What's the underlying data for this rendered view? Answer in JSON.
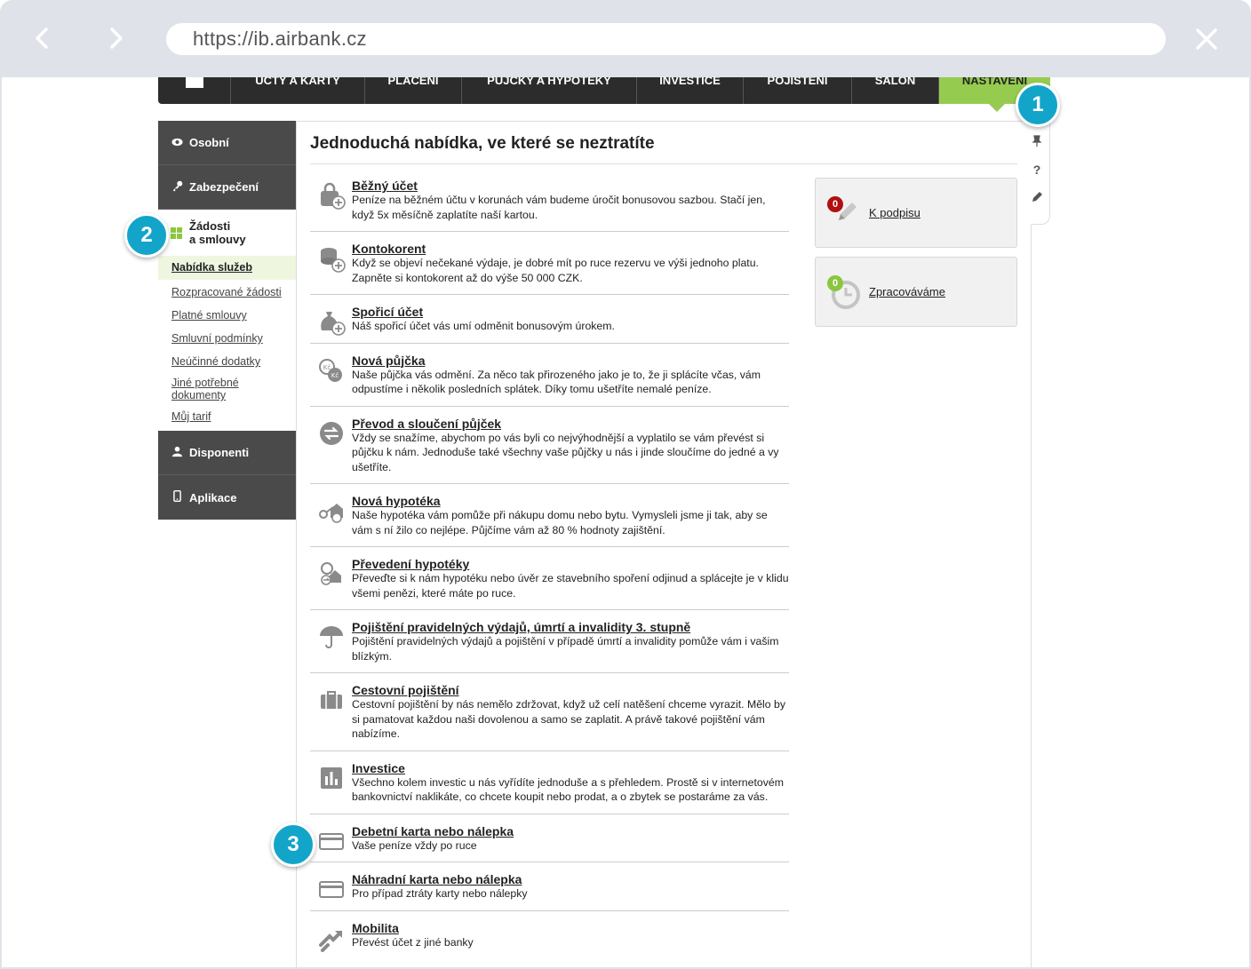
{
  "browser": {
    "url": "https://ib.airbank.cz"
  },
  "topmenu": {
    "items": [
      "ÚČTY A KARTY",
      "PLACENÍ",
      "PŮJČKY A HYPOTÉKY",
      "INVESTICE",
      "POJIŠTĚNÍ",
      "SALON",
      "NASTAVENÍ"
    ],
    "active": "NASTAVENÍ"
  },
  "sidebar": {
    "sections": [
      {
        "label": "Osobní",
        "icon": "eye-icon"
      },
      {
        "label": "Zabezpečení",
        "icon": "key-icon"
      }
    ],
    "active_section": {
      "line1": "Žádosti",
      "line2": "a smlouvy",
      "icon": "grid-icon"
    },
    "links": [
      "Nabídka služeb",
      "Rozpracované žádosti",
      "Platné smlouvy",
      "Smluvní podmínky",
      "Neúčinné dodatky",
      "Jiné potřebné dokumenty",
      "Můj tarif"
    ],
    "bottom_sections": [
      {
        "label": "Disponenti",
        "icon": "person-icon"
      },
      {
        "label": "Aplikace",
        "icon": "phone-icon"
      }
    ]
  },
  "main": {
    "title": "Jednoduchá nabídka, ve které se neztratíte",
    "offers": [
      {
        "title": "Běžný účet",
        "desc": "Peníze na běžném účtu v korunách vám budeme úročit bonusovou sazbou. Stačí jen, když 5x měsíčně zaplatíte naší kartou.",
        "icon": "wallet-plus-icon"
      },
      {
        "title": "Kontokorent",
        "desc": "Když se objeví nečekané výdaje, je dobré mít po ruce rezervu ve výši jednoho platu. Zapněte si kontokorent až do výše 50 000 CZK.",
        "icon": "coins-plus-icon"
      },
      {
        "title": "Spořicí účet",
        "desc": "Náš spořicí účet vás umí odměnit bonusovým úrokem.",
        "icon": "moneybag-plus-icon"
      },
      {
        "title": "Nová půjčka",
        "desc": "Naše půjčka vás odmění. Za něco tak přirozeného jako je to, že ji splácíte včas, vám odpustíme i několik posledních splátek. Díky tomu ušetříte nemalé peníze.",
        "icon": "kc-coins-icon"
      },
      {
        "title": "Převod a sloučení půjček",
        "desc": "Vždy se snažíme, abychom po vás byli co nejvýhodnější a vyplatilo se vám převést si půjčku k nám. Jednoduše také všechny vaše půjčky u nás i jinde sloučíme do jedné a vy ušetříte.",
        "icon": "transfer-arrows-icon"
      },
      {
        "title": "Nová hypotéka",
        "desc": "Naše hypotéka vám pomůže při nákupu domu nebo bytu. Vymysleli jsme ji tak, aby se vám s ní žilo co nejlépe. Půjčíme vám až 80 % hodnoty zajištění.",
        "icon": "house-keys-icon"
      },
      {
        "title": "Převedení hypotéky",
        "desc": "Převeďte si k nám hypotéku nebo úvěr ze stavebního spoření odjinud a splácejte je v klidu všemi penězi, které máte po ruce.",
        "icon": "house-transfer-icon"
      },
      {
        "title": "Pojištění pravidelných výdajů, úmrtí a invalidity 3. stupně",
        "desc": "Pojištění pravidelných výdajů a pojištění v případě úmrtí a invalidity pomůže vám i vašim blízkým.",
        "icon": "umbrella-icon"
      },
      {
        "title": "Cestovní pojištění",
        "desc": "Cestovní pojištění by nás nemělo zdržovat, když už celí natěšení chceme vyrazit. Mělo by si pamatovat každou naši dovolenou a samo se zaplatit. A právě takové pojištění vám nabízíme.",
        "icon": "suitcase-icon"
      },
      {
        "title": "Investice",
        "desc": "Všechno kolem investic u nás vyřídíte jednoduše a s přehledem. Prostě si v internetovém bankovnictví naklikáte, co chcete koupit nebo prodat, a o zbytek se postaráme za vás.",
        "icon": "bar-chart-icon"
      },
      {
        "title": "Debetní karta nebo nálepka",
        "desc": "Vaše peníze vždy po ruce",
        "icon": "card-icon"
      },
      {
        "title": "Náhradní karta nebo nálepka",
        "desc": "Pro případ ztráty karty nebo nálepky",
        "icon": "card-icon"
      },
      {
        "title": "Mobilita",
        "desc": "Převést účet z jiné banky",
        "icon": "move-arrows-icon"
      }
    ]
  },
  "right_panel": {
    "sign": {
      "label": "K podpisu",
      "count": "0",
      "color": "#b01010"
    },
    "processing": {
      "label": "Zpracováváme",
      "count": "0",
      "color": "#8cc63f"
    }
  },
  "rail_icons": [
    "pin-icon",
    "help-icon",
    "pencil-icon"
  ],
  "rail_help_glyph": "?",
  "callouts": [
    "1",
    "2",
    "3"
  ],
  "colors": {
    "accent_green": "#95cc50",
    "callout_blue": "#13a5c9",
    "dark_menu": "#2c2c2c",
    "sidebar_dark": "#4a4a4a"
  }
}
